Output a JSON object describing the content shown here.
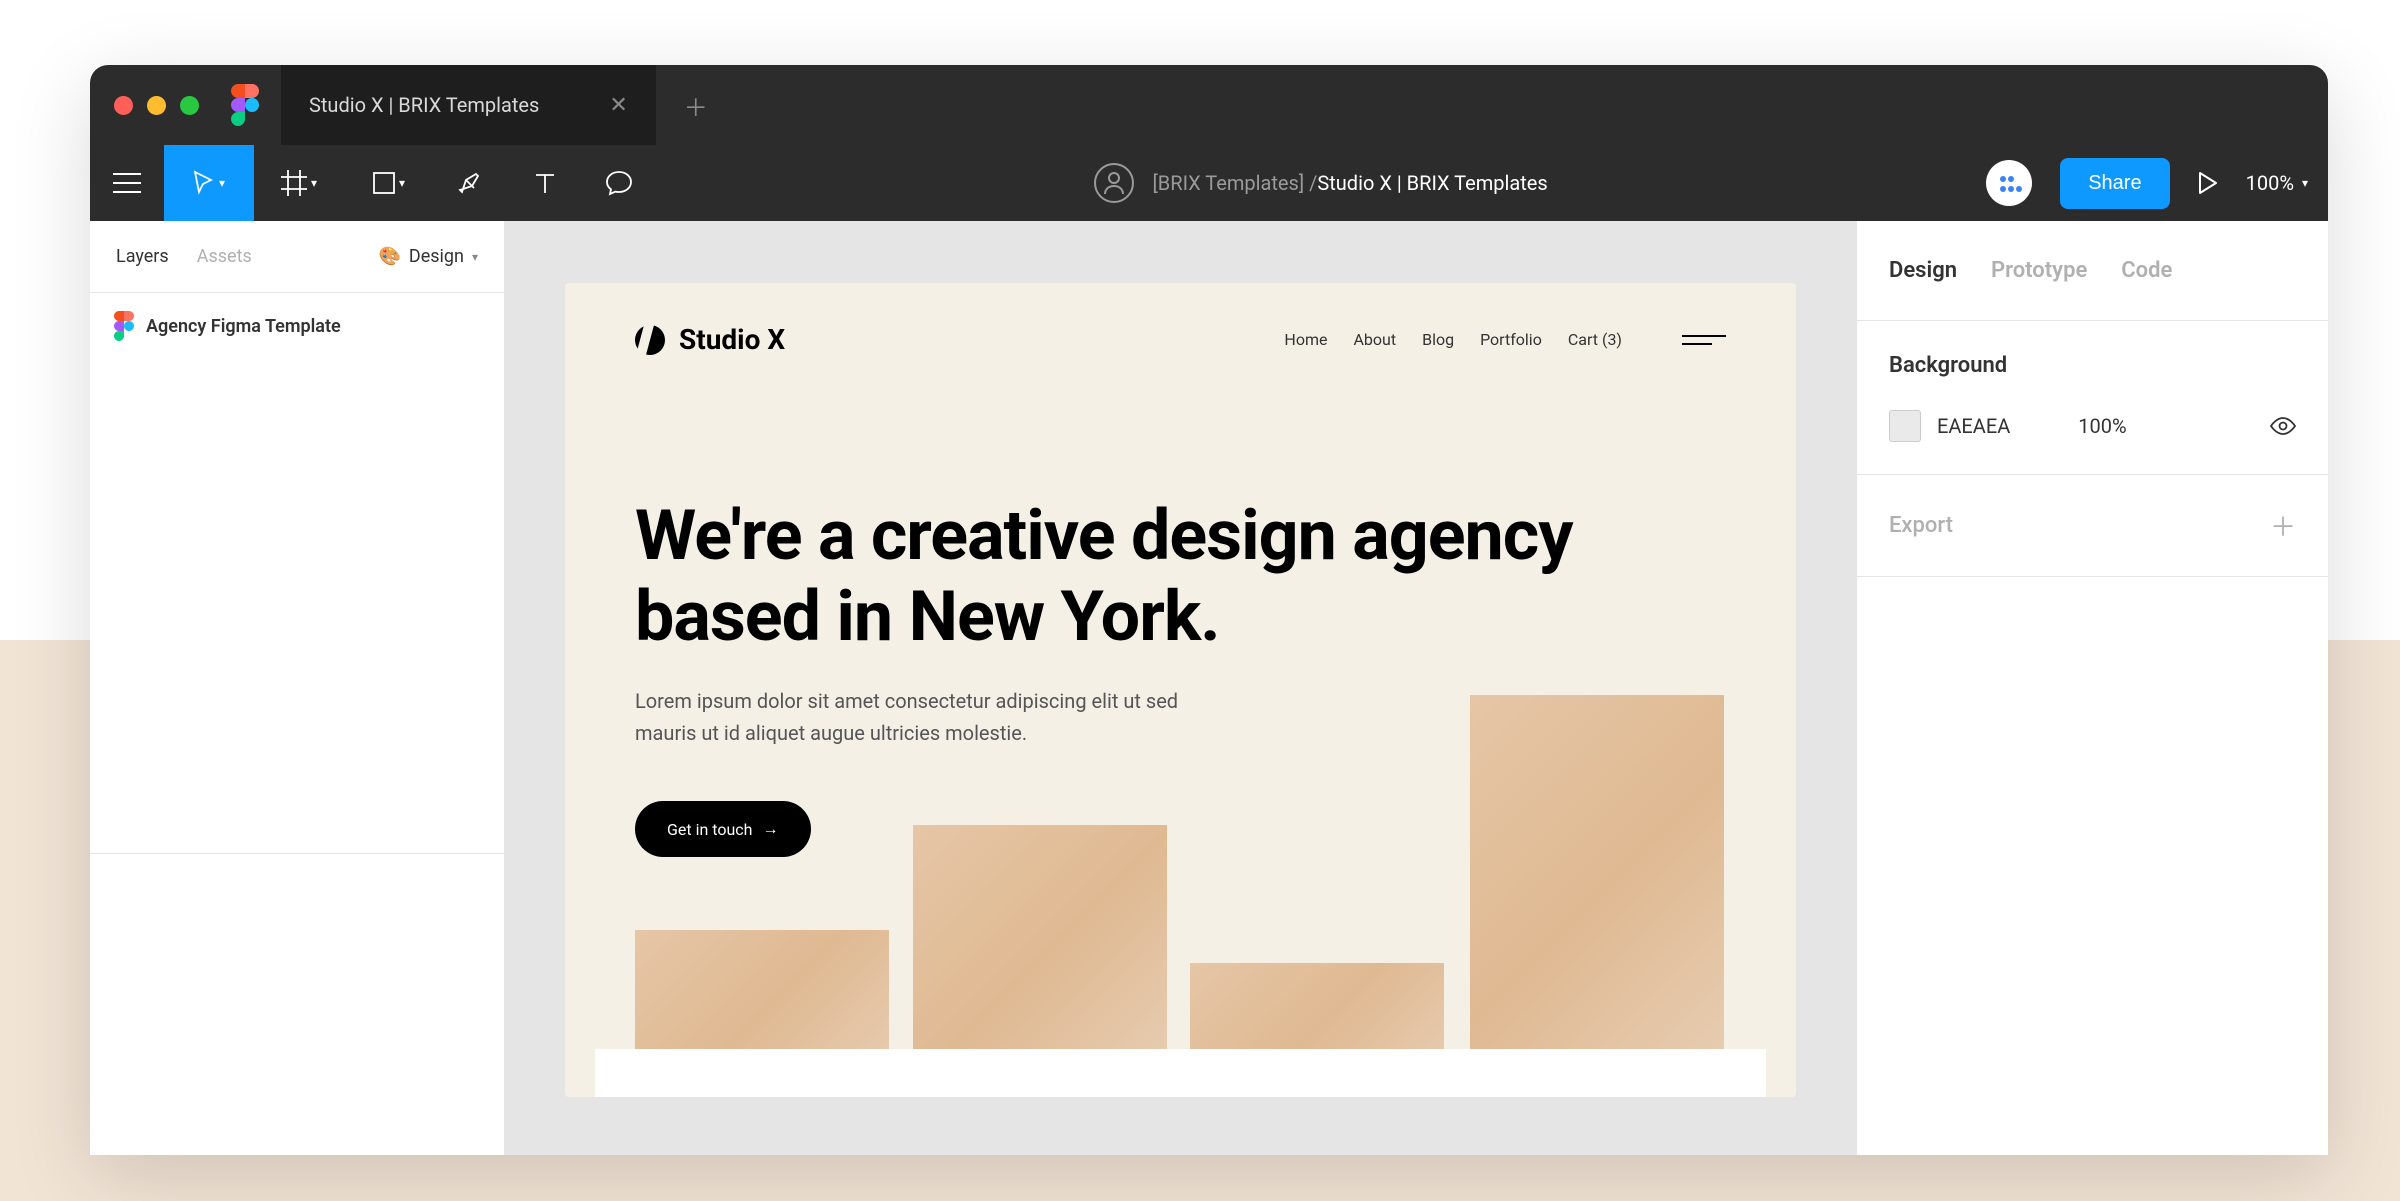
{
  "window": {
    "tab_title": "Studio X | BRIX Templates"
  },
  "toolbar": {
    "team_name": "[BRIX Templates] /",
    "doc_name": "Studio X | BRIX Templates",
    "share_label": "Share",
    "zoom": "100%"
  },
  "leftPanel": {
    "tabs": {
      "layers": "Layers",
      "assets": "Assets"
    },
    "page_label": "Design",
    "layer1": "Agency Figma Template"
  },
  "canvas": {
    "logo": "Studio X",
    "nav": {
      "home": "Home",
      "about": "About",
      "blog": "Blog",
      "portfolio": "Portfolio",
      "cart": "Cart (3)"
    },
    "hero_title": "We're a creative design agency based in New York.",
    "hero_subtitle": "Lorem ipsum dolor sit amet consectetur adipiscing elit ut sed mauris ut id aliquet augue ultricies molestie.",
    "cta_label": "Get in touch"
  },
  "rightPanel": {
    "tabs": {
      "design": "Design",
      "prototype": "Prototype",
      "code": "Code"
    },
    "background_label": "Background",
    "bg_hex": "EAEAEA",
    "bg_opacity": "100%",
    "export_label": "Export"
  }
}
